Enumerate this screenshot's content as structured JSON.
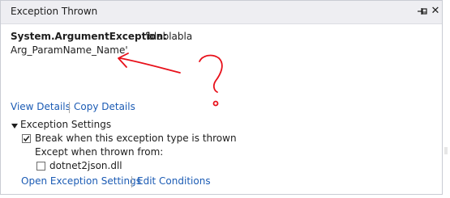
{
  "window": {
    "title": "Exception Thrown",
    "close_glyph": "✕"
  },
  "exception": {
    "type": "System.ArgumentException:",
    "message_line1": "'blablabla",
    "message_line2": "Arg_ParamName_Name'"
  },
  "links": {
    "view_details": "View Details",
    "copy_details": "Copy Details",
    "open_exception_settings": "Open Exception Settings",
    "edit_conditions": "Edit Conditions"
  },
  "exception_settings": {
    "section_label": "Exception Settings",
    "expanded": true,
    "break_when_thrown": {
      "label": "Break when this exception type is thrown",
      "checked": true
    },
    "except_label": "Except when thrown from:",
    "modules": [
      {
        "label": "dotnet2json.dll",
        "checked": false
      }
    ]
  },
  "annotation": {
    "color": "#e8101a"
  },
  "colors": {
    "link": "#1b5bb4",
    "title_bar": "#eeeef2"
  }
}
